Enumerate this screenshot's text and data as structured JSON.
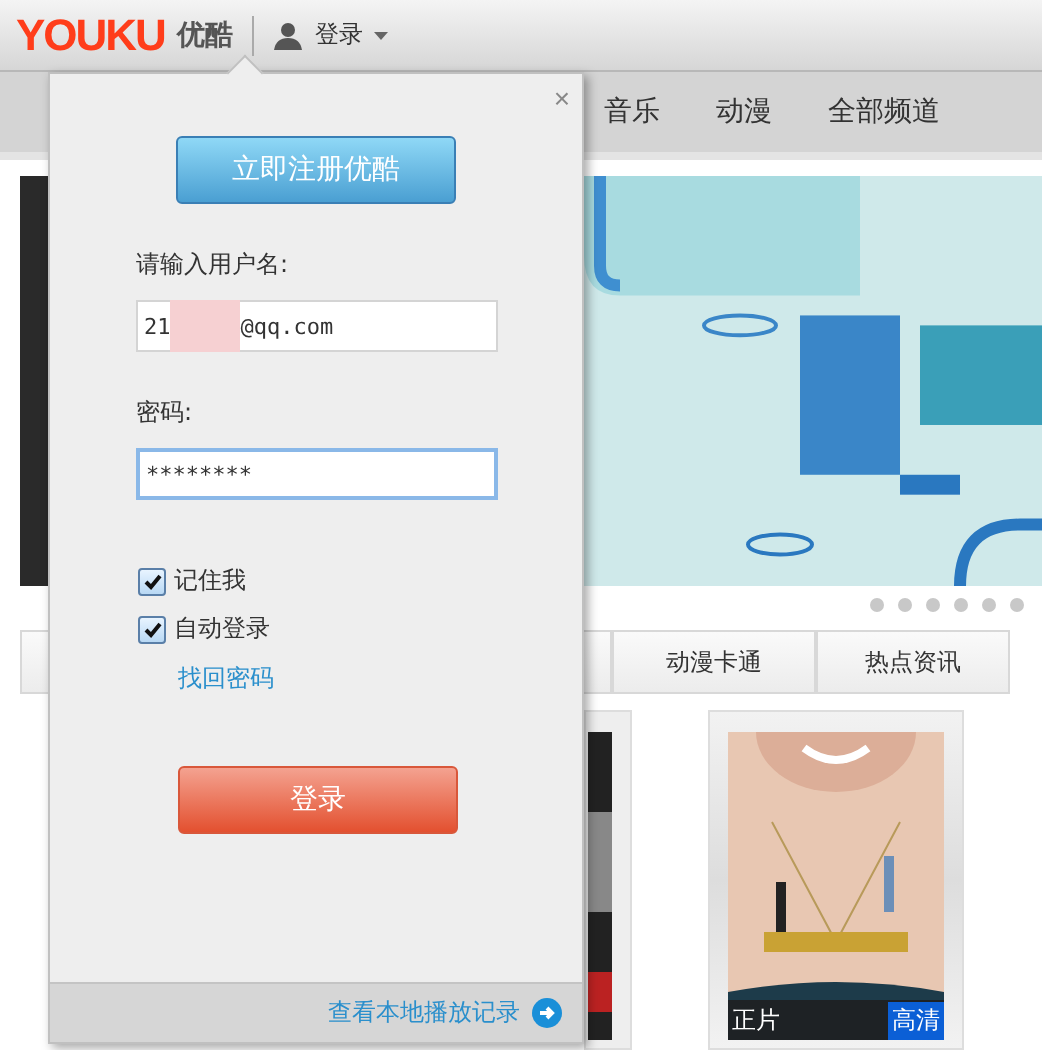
{
  "header": {
    "logo": "YOUKU",
    "logo_cn": "优酷",
    "login": "登录"
  },
  "nav": [
    "音乐",
    "动漫",
    "全部频道"
  ],
  "banner": {
    "kind": "picture",
    "dots": [
      {
        "selected": false
      },
      {
        "selected": false
      },
      {
        "selected": false
      },
      {
        "selected": false
      },
      {
        "selected": false
      },
      {
        "selected": false
      }
    ]
  },
  "category_tabs": [
    "动漫卡通",
    "热点资讯"
  ],
  "card": {
    "kind": "picture",
    "tag": "正片",
    "quality": "高清"
  },
  "login_popup": {
    "close": "×",
    "register": "立即注册优酷",
    "username_label": "请输入用户名:",
    "username_prefix": "21",
    "username_redacted": true,
    "username_suffix": "@qq.com",
    "password_label": "密码:",
    "password": "********",
    "password_focused": true,
    "options": [
      {
        "label": "记住我",
        "checked": true
      },
      {
        "label": "自动登录",
        "checked": true
      }
    ],
    "forgot": "找回密码",
    "submit": "登录",
    "history": "查看本地播放记录"
  }
}
